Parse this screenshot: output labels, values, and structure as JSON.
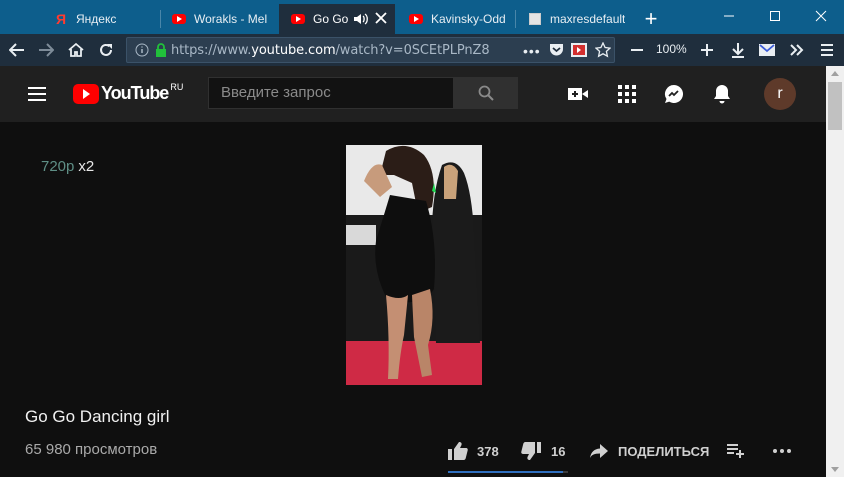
{
  "browser": {
    "tabs": [
      {
        "label": "Яндекс",
        "icon": "yandex-icon"
      },
      {
        "label": "Worakls - Mel",
        "icon": "youtube-icon"
      },
      {
        "label": "Go Go D",
        "icon": "youtube-icon"
      },
      {
        "label": "Kavinsky-Odd",
        "icon": "youtube-icon"
      },
      {
        "label": "maxresdefault",
        "icon": "image-icon"
      }
    ],
    "address_prefix": "https://www.",
    "address_domain": "youtube.com",
    "address_path": "/watch?v=0SCEtPLPnZ8",
    "zoom": "100%"
  },
  "youtube": {
    "logo_text": "YouTube",
    "region": "RU",
    "search_placeholder": "Введите запрос",
    "avatar_letter": "r"
  },
  "video": {
    "quality": "720p",
    "speed": "x2",
    "title": "Go Go Dancing girl",
    "views": "65 980 просмотров",
    "likes": "378",
    "dislikes": "16",
    "share_label": "ПОДЕЛИТЬСЯ",
    "like_ratio": 0.96
  },
  "colors": {
    "tab_strip": "#0d5e8c",
    "toolbar": "#1f2e3d",
    "yt_red": "#ff0000",
    "background": "#0f0f0f"
  }
}
